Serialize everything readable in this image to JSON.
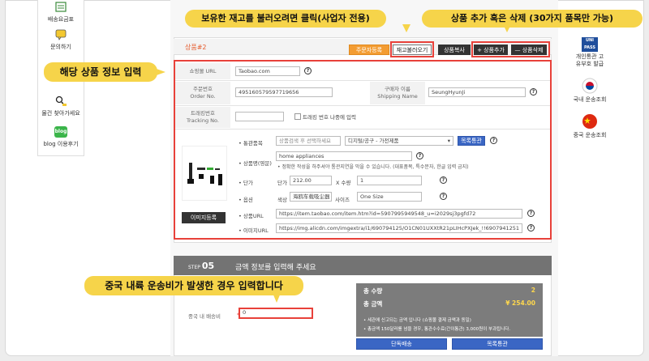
{
  "callouts": {
    "load_stock": "보유한 재고를 불러오려면 클릭(사업자 전용)",
    "add_delete": "상품 추가 혹은 삭제 (30가지 품목만 가능)",
    "enter_info": "해당 상품 정보 입력",
    "shipping_note": "중국 내륙 운송비가 발생한 경우 입력합니다"
  },
  "left_menu": [
    {
      "label": "배송요금표"
    },
    {
      "label": "문의하기"
    },
    {
      "label": "물건 찾아가세요"
    },
    {
      "label": "blog 이용후기",
      "badge": "blog"
    }
  ],
  "right_menu": [
    {
      "label": "개인통관 고유부호 발급",
      "badge": "UNI PASS"
    },
    {
      "label": "국내 운송조회"
    },
    {
      "label": "중국 운송조회"
    }
  ],
  "product": {
    "title": "상품#2",
    "buttons": {
      "customs_register": "주문자등록",
      "load_stock": "재고불러오기",
      "copy": "상품복사",
      "add": "+ 상품추가",
      "delete": "— 상품삭제"
    },
    "shopping_url_label": "쇼핑몰 URL",
    "shopping_url_value": "Taobao.com",
    "order_no_label_ko": "주문번호",
    "order_no_label_en": "Order No.",
    "order_no_value": "495160579597719656",
    "shipping_name_label_ko": "구매자 이름",
    "shipping_name_label_en": "Shipping Name",
    "shipping_name_value": "SeungHyunJi",
    "tracking_label_ko": "트래킹번호",
    "tracking_label_en": "Tracking No.",
    "tracking_value": "",
    "tracking_later_label": "트래킹 번호 나중에 입력",
    "customs_item_label": "• 통관품목",
    "customs_item_placeholder": "상품검색 후 선택하세요",
    "category_value": "디지털/공구 - 가전제품",
    "customs_list_button": "목록통관",
    "product_name_label": "• 상품명(영문)",
    "product_name_value": "home appliances",
    "product_name_note": "• 정확한 작성을 하주셔야 통관지연을 막을 수 있습니다. (대표품목, 특수문자, 한글 입력 금지)",
    "price_label": "• 단가",
    "unit_price_label": "단가",
    "unit_price_value": "212.00",
    "qty_label": "X 수량",
    "qty_value": "1",
    "option_label": "• 옵션",
    "color_label": "색상",
    "color_value": "海鸥车载吸尘器【现",
    "size_label": "사이즈",
    "size_value": "One Size",
    "product_url_label": "• 상품URL",
    "product_url_value": "https://item.taobao.com/item.htm?id=5907995949548_u=i2029sj3pgfd72",
    "image_url_label": "• 이미지URL",
    "image_url_value": "https://img.alicdn.com/imgextra/i1/690794125/O1CN01UXXtR21pLIHcPXJek_!!6907941251",
    "image_button": "이미지등록"
  },
  "step": {
    "number_prefix": "STEP",
    "number": "05",
    "title": "금액 정보를 입력해 주세요",
    "shipping_cost_label": "중국 내 배송비",
    "shipping_cost_value": "0"
  },
  "summary": {
    "total_qty_label": "총 수량",
    "total_qty_value": "2",
    "total_amount_label": "총 금액",
    "total_amount_value": "¥ 254.00",
    "note1": "• 세관에 신고되는 금액 입니다 (쇼핑몰 결제 금액과 동일)",
    "note2": "• 총금액 150달러를 넘을 경우, 통관수수료(간이통관) 3,000원이 부과됩니다.",
    "single_ship_button": "단독배송",
    "list_customs_button": "목록통관"
  },
  "colors": {
    "callout": "#f6d44a",
    "highlight": "#e8413a",
    "accent_orange": "#f39c32",
    "accent_blue": "#3a66c4",
    "step_bar": "#737373",
    "summary_bg": "#7c7c7c"
  }
}
